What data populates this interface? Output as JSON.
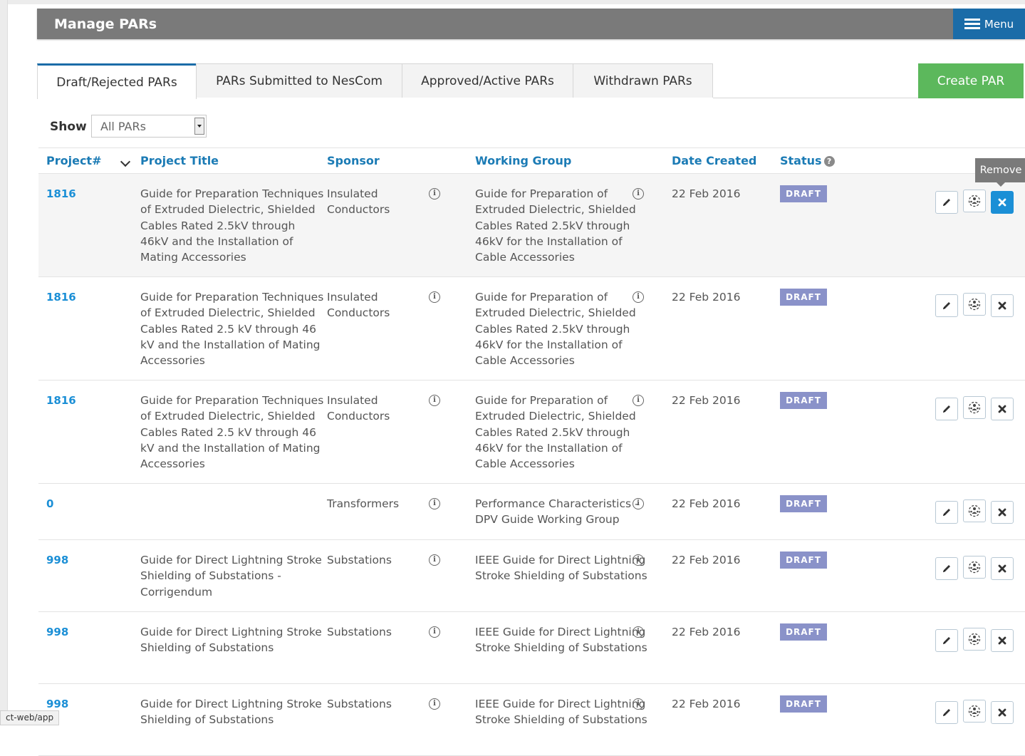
{
  "header": {
    "title": "Manage PARs",
    "menu_label": "Menu"
  },
  "tabs": [
    {
      "label": "Draft/Rejected PARs",
      "active": true
    },
    {
      "label": "PARs Submitted to NesCom",
      "active": false
    },
    {
      "label": "Approved/Active PARs",
      "active": false
    },
    {
      "label": "Withdrawn PARs",
      "active": false
    }
  ],
  "create_button": "Create PAR",
  "filter": {
    "label": "Show",
    "value": "All PARs"
  },
  "columns": {
    "project": "Project#",
    "title": "Project Title",
    "sponsor": "Sponsor",
    "working_group": "Working Group",
    "date": "Date Created",
    "status": "Status"
  },
  "icons": {
    "sort": "chevron-down-icon",
    "help": "question-circle-icon",
    "info": "info-icon",
    "edit": "pencil-icon",
    "group": "group-icon",
    "remove": "close-icon"
  },
  "tooltip": "Remove",
  "rows": [
    {
      "project": "1816",
      "title": "Guide for Preparation Techniques of Extruded Dielectric, Shielded Cables Rated 2.5kV through 46kV and the Installation of Mating Accessories",
      "sponsor": "Insulated Conductors",
      "working_group": "Guide for Preparation of Extruded Dielectric, Shielded Cables Rated 2.5kV through 46kV for the Installation of Cable Accessories",
      "date": "22 Feb 2016",
      "status": "DRAFT"
    },
    {
      "project": "1816",
      "title": "Guide for Preparation Techniques of Extruded Dielectric, Shielded Cables Rated 2.5 kV through 46 kV and the Installation of Mating Accessories",
      "sponsor": "Insulated Conductors",
      "working_group": "Guide for Preparation of Extruded Dielectric, Shielded Cables Rated 2.5kV through 46kV for the Installation of Cable Accessories",
      "date": "22 Feb 2016",
      "status": "DRAFT"
    },
    {
      "project": "1816",
      "title": "Guide for Preparation Techniques of Extruded Dielectric, Shielded Cables Rated 2.5 kV through 46 kV and the Installation of Mating Accessories",
      "sponsor": "Insulated Conductors",
      "working_group": "Guide for Preparation of Extruded Dielectric, Shielded Cables Rated 2.5kV through 46kV for the Installation of Cable Accessories",
      "date": "22 Feb 2016",
      "status": "DRAFT"
    },
    {
      "project": "0",
      "title": "",
      "sponsor": "Transformers",
      "working_group": "Performance Characteristics - DPV Guide Working Group",
      "date": "22 Feb 2016",
      "status": "DRAFT"
    },
    {
      "project": "998",
      "title": "Guide for Direct Lightning Stroke Shielding of Substations - Corrigendum",
      "sponsor": "Substations",
      "working_group": "IEEE Guide for Direct Lightning Stroke Shielding of Substations",
      "date": "22 Feb 2016",
      "status": "DRAFT"
    },
    {
      "project": "998",
      "title": "Guide for Direct Lightning Stroke Shielding of Substations",
      "sponsor": "Substations",
      "working_group": "IEEE Guide for Direct Lightning Stroke Shielding of Substations",
      "date": "22 Feb 2016",
      "status": "DRAFT"
    },
    {
      "project": "998",
      "title": "Guide for Direct Lightning Stroke Shielding of Substations",
      "sponsor": "Substations",
      "working_group": "IEEE Guide for Direct Lightning Stroke Shielding of Substations",
      "date": "22 Feb 2016",
      "status": "DRAFT"
    }
  ],
  "status_bar": "ct-web/app"
}
